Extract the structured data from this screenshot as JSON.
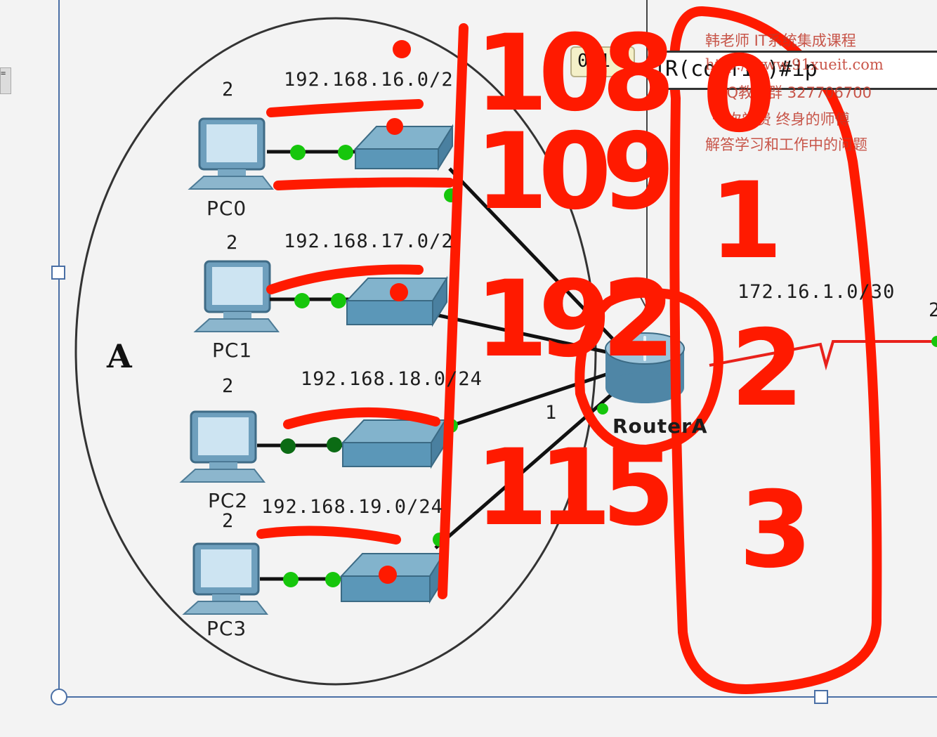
{
  "diagram": {
    "area_label": "A",
    "pcs": [
      {
        "name": "PC0",
        "count": "2"
      },
      {
        "name": "PC1",
        "count": "2"
      },
      {
        "name": "PC2",
        "count": "2"
      },
      {
        "name": "PC3",
        "count": "2"
      }
    ],
    "networks": [
      "192.168.16.0/2",
      "192.168.17.0/2",
      "192.168.18.0/24",
      "192.168.19.0/24"
    ],
    "router_label": "RouterA",
    "router_port_label": "1",
    "wan_network": "172.16.1.0/30",
    "right_edge_digit": "2",
    "tooltip": "0/1",
    "cli_text": "R(config)#ip",
    "side_tab": "="
  },
  "watermark": {
    "line1": "韩老师 IT系统集成课程",
    "line2": "http://www.91xueit.com",
    "line3": "QQ教学群 327706700",
    "line4": "一次学费 终身的师傅",
    "line5": "解答学习和工作中的问题"
  },
  "handwriting": {
    "column1": [
      "108",
      "109",
      "192",
      "115"
    ],
    "column2": [
      "0",
      "1",
      "2",
      "3"
    ]
  },
  "colors": {
    "ink_red": "#ff1a00",
    "link_dot_green": "#16c60c",
    "link_dot_dark_green": "#0b6b14",
    "wan_link_red": "#e8211b",
    "device_blue": "#5b97b8"
  }
}
